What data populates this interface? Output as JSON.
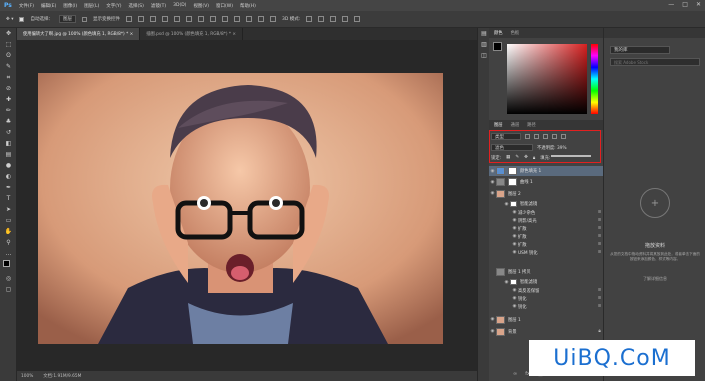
{
  "app": {
    "logo": "Ps"
  },
  "menubar": [
    "文件(F)",
    "编辑(E)",
    "图像(I)",
    "图层(L)",
    "文字(Y)",
    "选择(S)",
    "滤镜(T)",
    "3D(D)",
    "视图(V)",
    "窗口(W)",
    "帮助(H)"
  ],
  "window_controls": [
    "—",
    "□",
    "✕"
  ],
  "options": {
    "auto_select_label": "自动选择：",
    "auto_select_value": "图层",
    "show_transform_label": "显示变换控件"
  },
  "tabs": [
    {
      "label": "使用偏转大了啊.jpg @ 100% (颜色填充 1, RGB/8*) *",
      "active": true
    },
    {
      "label": "插图.psd @ 100% (颜色填充 1, RGB/8*) *",
      "active": false
    }
  ],
  "status": {
    "zoom": "100%",
    "doc": "文档:1.91M/9.65M"
  },
  "color_panel": {
    "tabs": [
      "颜色",
      "色板"
    ],
    "hue_start": "#ff0000",
    "base_color": "#e03030"
  },
  "layers_panel": {
    "tabs": [
      "图层",
      "通道",
      "路径"
    ],
    "filter_label": "类型",
    "blend_mode": "滤色",
    "opacity_label": "不透明度: 39%",
    "lock_label": "锁定:",
    "fill_label": "填充:",
    "layers": [
      {
        "name": "颜色填充 1",
        "visible": true,
        "kind": "fill"
      },
      {
        "name": "曲线 1",
        "visible": true,
        "kind": "adjust"
      },
      {
        "name": "图层 2",
        "visible": true,
        "kind": "smart"
      },
      {
        "name": "智能滤镜",
        "visible": true,
        "kind": "sub"
      },
      {
        "name": "减少杂色",
        "visible": true,
        "kind": "filter"
      },
      {
        "name": "阴影/高光",
        "visible": true,
        "kind": "filter"
      },
      {
        "name": "扩散",
        "visible": true,
        "kind": "filter"
      },
      {
        "name": "扩散",
        "visible": true,
        "kind": "filter"
      },
      {
        "name": "扩散",
        "visible": true,
        "kind": "filter"
      },
      {
        "name": "USM 锐化",
        "visible": true,
        "kind": "filter"
      },
      {
        "name": "图层 1 拷贝",
        "visible": false,
        "kind": "smart"
      },
      {
        "name": "智能滤镜",
        "visible": true,
        "kind": "sub"
      },
      {
        "name": "高反差保留",
        "visible": true,
        "kind": "filter"
      },
      {
        "name": "锐化",
        "visible": true,
        "kind": "filter"
      },
      {
        "name": "锐化",
        "visible": true,
        "kind": "filter"
      },
      {
        "name": "图层 1",
        "visible": true,
        "kind": "photo"
      },
      {
        "name": "背景",
        "visible": true,
        "kind": "photo"
      }
    ]
  },
  "libraries": {
    "dropdown": "我的库",
    "search_placeholder": "搜索 Adobe Stock",
    "drag_title": "拖放资料",
    "drag_text": "从您的文档中拖动资料并将其放到此处，或者单击下面的按钮来添加颜色、样式等内容。",
    "footer_text": "了解详细信息"
  },
  "watermark": "UiBQ.CoM"
}
